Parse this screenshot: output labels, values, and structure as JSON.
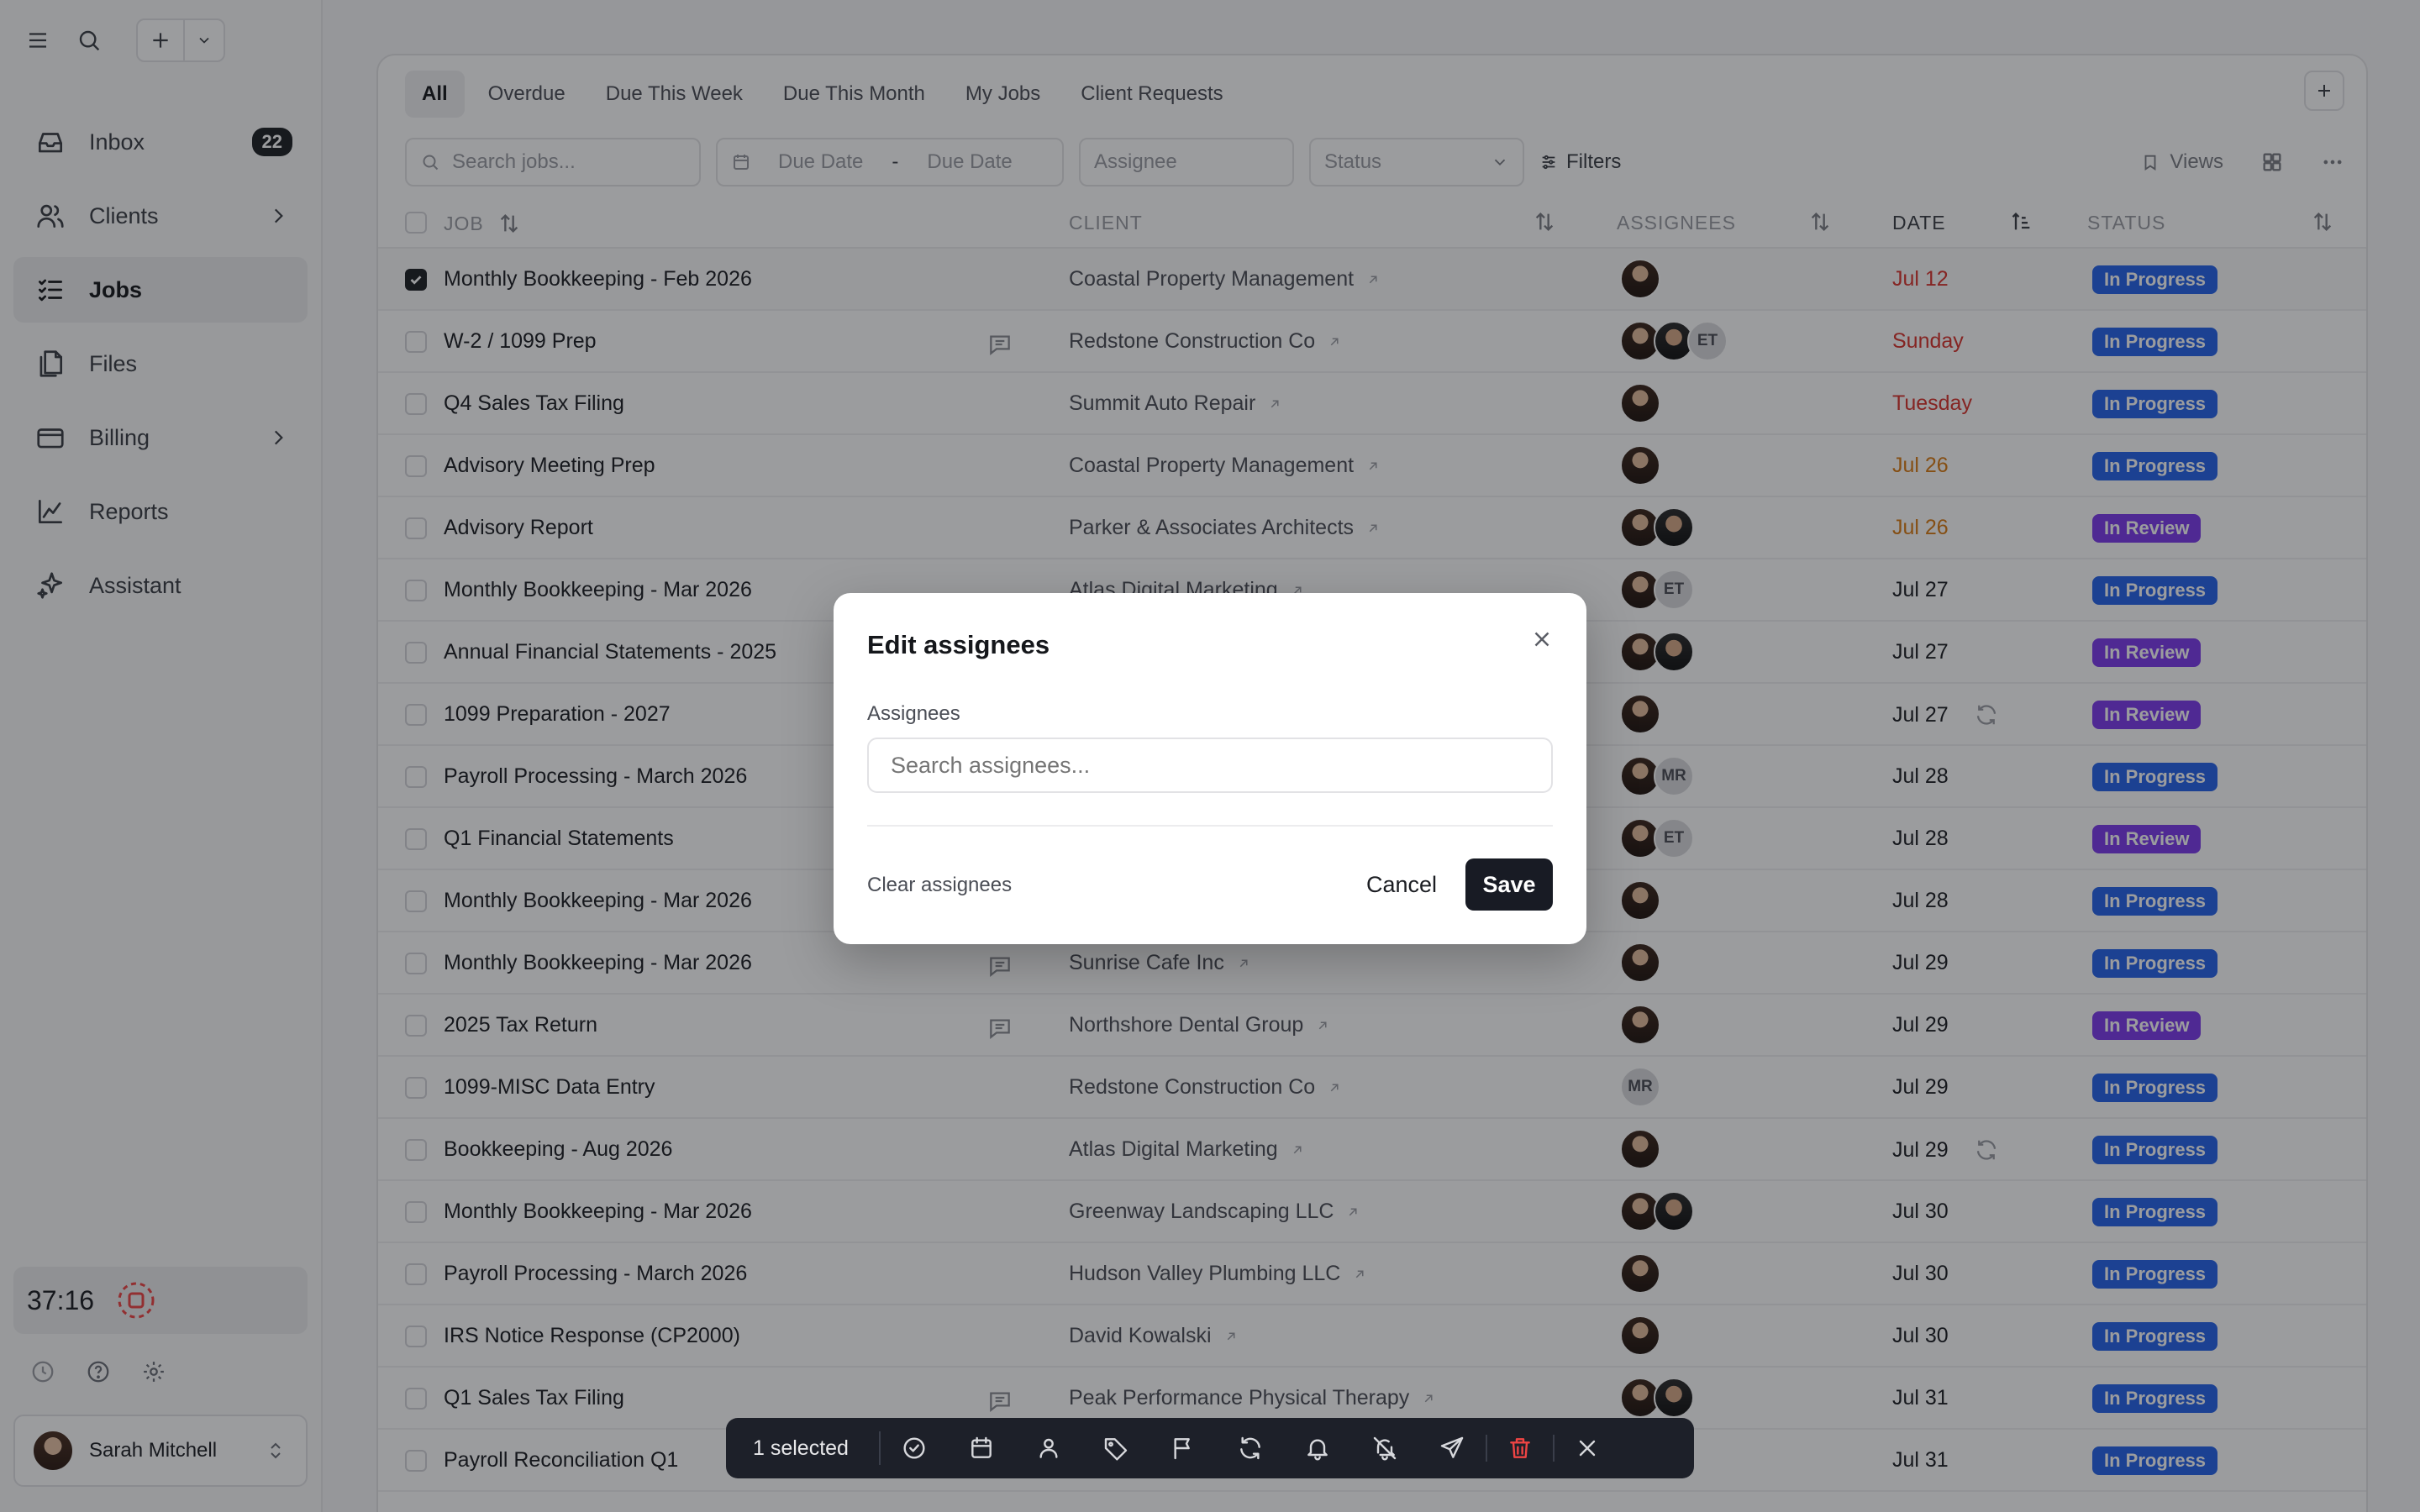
{
  "sidebar": {
    "nav": [
      {
        "label": "Inbox",
        "badge": "22",
        "icon": "inbox-icon"
      },
      {
        "label": "Clients",
        "icon": "users-icon",
        "chevron": true
      },
      {
        "label": "Jobs",
        "icon": "jobs-list-icon",
        "active": true
      },
      {
        "label": "Files",
        "icon": "files-icon"
      },
      {
        "label": "Billing",
        "icon": "billing-card-icon",
        "chevron": true
      },
      {
        "label": "Reports",
        "icon": "chart-icon"
      },
      {
        "label": "Assistant",
        "icon": "sparkle-icon"
      }
    ],
    "timer": "37:16",
    "user": "Sarah Mitchell"
  },
  "tabs": [
    "All",
    "Overdue",
    "Due This Week",
    "Due This Month",
    "My Jobs",
    "Client Requests"
  ],
  "filters": {
    "search_placeholder": "Search jobs...",
    "due_from": "Due Date",
    "due_sep": "-",
    "due_to": "Due Date",
    "assignee_placeholder": "Assignee",
    "status_placeholder": "Status",
    "filters_label": "Filters",
    "views_label": "Views"
  },
  "columns": {
    "job": "JOB",
    "client": "CLIENT",
    "assignees": "ASSIGNEES",
    "date": "DATE",
    "status": "STATUS"
  },
  "rows": [
    {
      "job": "Monthly Bookkeeping - Feb 2026",
      "client": "Coastal Property Management",
      "assignees": [
        "f"
      ],
      "date": "Jul 12",
      "date_color": "red",
      "status": "In Progress",
      "selected": true
    },
    {
      "job": "W-2 / 1099 Prep",
      "comment": true,
      "client": "Redstone Construction Co",
      "assignees": [
        "f",
        "m",
        "ET"
      ],
      "date": "Sunday",
      "date_color": "red",
      "status": "In Progress"
    },
    {
      "job": "Q4 Sales Tax Filing",
      "client": "Summit Auto Repair",
      "assignees": [
        "f"
      ],
      "date": "Tuesday",
      "date_color": "red",
      "status": "In Progress"
    },
    {
      "job": "Advisory Meeting Prep",
      "client": "Coastal Property Management",
      "assignees": [
        "f"
      ],
      "date": "Jul 26",
      "date_color": "orange",
      "status": "In Progress"
    },
    {
      "job": "Advisory Report",
      "client": "Parker & Associates Architects",
      "assignees": [
        "f",
        "m"
      ],
      "date": "Jul 26",
      "date_color": "orange",
      "status": "In Review"
    },
    {
      "job": "Monthly Bookkeeping - Mar 2026",
      "client": "Atlas Digital Marketing",
      "assignees": [
        "f",
        "ET"
      ],
      "date": "Jul 27",
      "status": "In Progress"
    },
    {
      "job": "Annual Financial Statements - 2025",
      "client": "",
      "assignees": [
        "f",
        "m"
      ],
      "date": "Jul 27",
      "status": "In Review"
    },
    {
      "job": "1099 Preparation - 2027",
      "client": "",
      "assignees": [
        "f"
      ],
      "date": "Jul 27",
      "recurring": true,
      "status": "In Review"
    },
    {
      "job": "Payroll Processing - March 2026",
      "client": "",
      "assignees": [
        "f",
        "MR"
      ],
      "date": "Jul 28",
      "status": "In Progress"
    },
    {
      "job": "Q1 Financial Statements",
      "client": "",
      "assignees": [
        "f",
        "ET"
      ],
      "date": "Jul 28",
      "status": "In Review"
    },
    {
      "job": "Monthly Bookkeeping - Mar 2026",
      "client": "",
      "assignees": [
        "f"
      ],
      "date": "Jul 28",
      "status": "In Progress"
    },
    {
      "job": "Monthly Bookkeeping - Mar 2026",
      "comment": true,
      "client": "Sunrise Cafe Inc",
      "assignees": [
        "f"
      ],
      "date": "Jul 29",
      "status": "In Progress"
    },
    {
      "job": "2025 Tax Return",
      "comment": true,
      "client": "Northshore Dental Group",
      "assignees": [
        "f"
      ],
      "date": "Jul 29",
      "status": "In Review"
    },
    {
      "job": "1099-MISC Data Entry",
      "client": "Redstone Construction Co",
      "assignees": [
        "MR"
      ],
      "date": "Jul 29",
      "status": "In Progress"
    },
    {
      "job": "Bookkeeping - Aug 2026",
      "client": "Atlas Digital Marketing",
      "assignees": [
        "f"
      ],
      "date": "Jul 29",
      "recurring": true,
      "status": "In Progress"
    },
    {
      "job": "Monthly Bookkeeping - Mar 2026",
      "client": "Greenway Landscaping LLC",
      "assignees": [
        "f",
        "m"
      ],
      "date": "Jul 30",
      "status": "In Progress"
    },
    {
      "job": "Payroll Processing - March 2026",
      "client": "Hudson Valley Plumbing LLC",
      "assignees": [
        "f"
      ],
      "date": "Jul 30",
      "status": "In Progress"
    },
    {
      "job": "IRS Notice Response (CP2000)",
      "client": "David Kowalski",
      "assignees": [
        "f"
      ],
      "date": "Jul 30",
      "status": "In Progress"
    },
    {
      "job": "Q1 Sales Tax Filing",
      "comment": true,
      "client": "Peak Performance Physical Therapy",
      "assignees": [
        "f",
        "m"
      ],
      "date": "Jul 31",
      "status": "In Progress"
    },
    {
      "job": "Payroll Reconciliation Q1",
      "client": "",
      "assignees": [
        "f"
      ],
      "date": "Jul 31",
      "status": "In Progress"
    }
  ],
  "modal": {
    "title": "Edit assignees",
    "label": "Assignees",
    "placeholder": "Search assignees...",
    "clear": "Clear assignees",
    "cancel": "Cancel",
    "save": "Save"
  },
  "bulk": {
    "selected": "1 selected",
    "actions": [
      "check-circle-icon",
      "calendar-icon",
      "person-icon",
      "tag-icon",
      "flag-icon",
      "refresh-icon",
      "bell-icon",
      "bell-off-icon",
      "send-icon",
      "trash-icon",
      "close-icon"
    ]
  },
  "colors": {
    "in_progress": "#2563eb",
    "in_review": "#7c3aed",
    "overdue": "#d9322c",
    "due_soon": "#d97a12"
  }
}
